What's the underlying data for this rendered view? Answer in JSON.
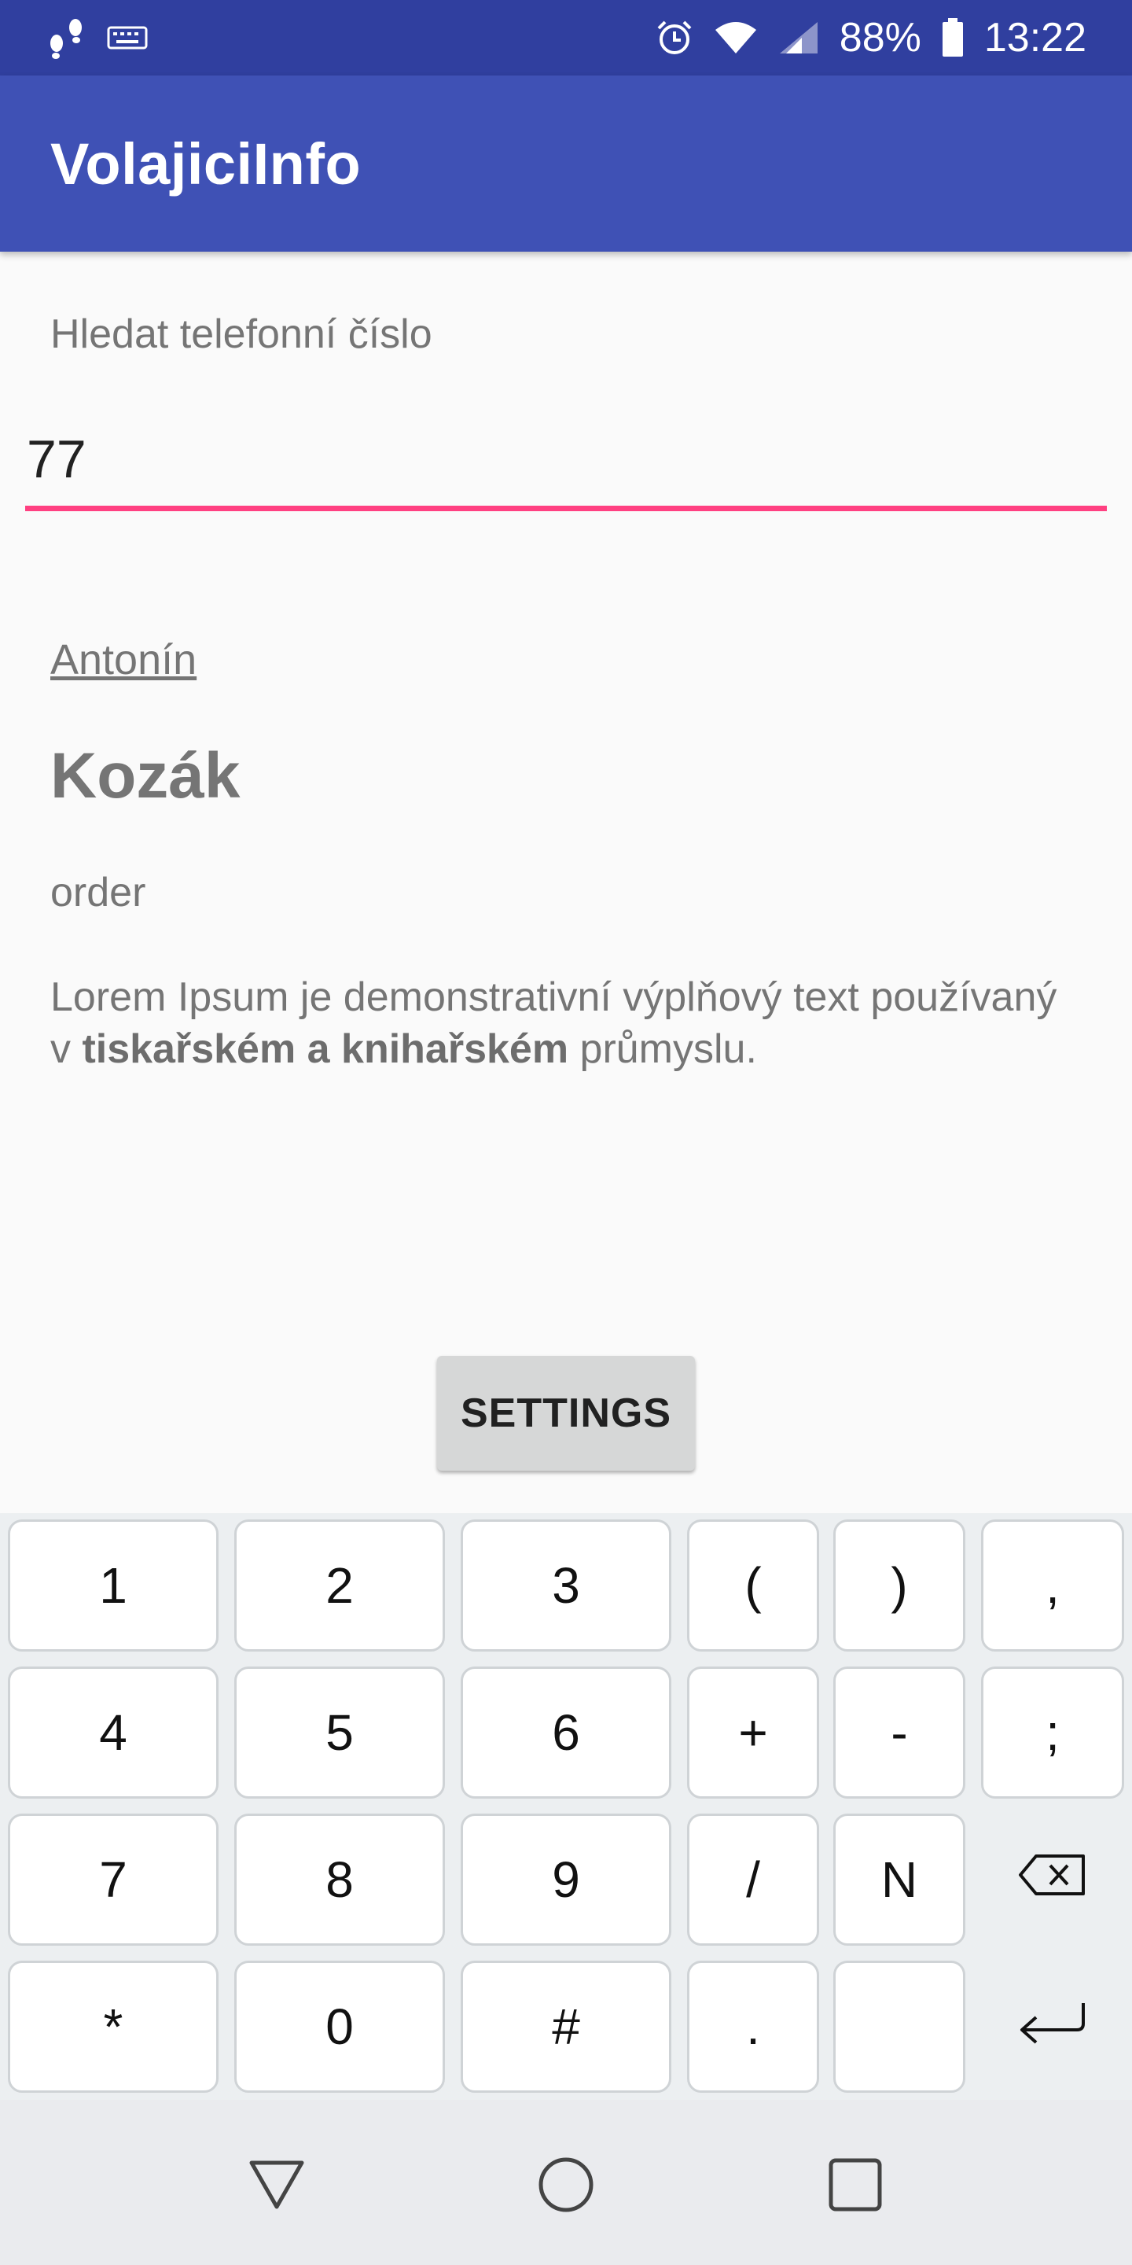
{
  "status_bar": {
    "battery": "88%",
    "time": "13:22",
    "icons": [
      "footsteps-icon",
      "keyboard-icon",
      "alarm-icon",
      "wifi-icon",
      "signal-icon",
      "battery-icon"
    ]
  },
  "app": {
    "title": "VolajiciInfo"
  },
  "search": {
    "label": "Hledat telefonní číslo",
    "value": "77"
  },
  "contact": {
    "first_name": "Antonín",
    "last_name": "Kozák",
    "order": "order",
    "description_part1": "Lorem Ipsum je demonstrativní výplňový text používaný v ",
    "description_bold": "tiskařském a knihařském",
    "description_part2": " průmyslu."
  },
  "settings_button": {
    "label": "SETTINGS"
  },
  "keyboard": {
    "row1": [
      "1",
      "2",
      "3",
      "(",
      ")",
      ","
    ],
    "row2": [
      "4",
      "5",
      "6",
      "+",
      "-",
      ";"
    ],
    "row3": [
      "7",
      "8",
      "9",
      "/",
      "N"
    ],
    "row4": [
      "*",
      "0",
      "#",
      "."
    ]
  },
  "colors": {
    "status_bar": "#303f9f",
    "app_bar": "#3f51b5",
    "accent": "#ff4081"
  }
}
